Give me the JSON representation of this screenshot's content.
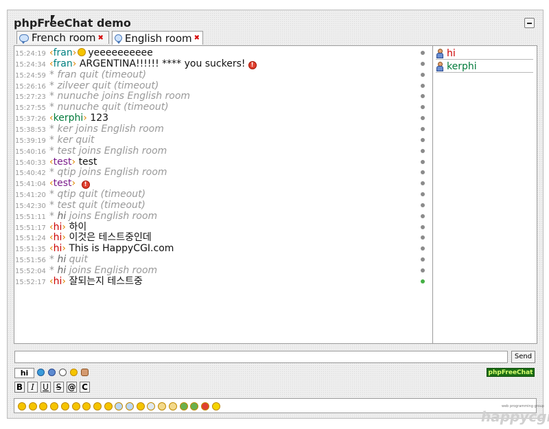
{
  "header": {
    "title": "phpFreeChat demo"
  },
  "tabs": [
    {
      "label": "French room",
      "active": false
    },
    {
      "label": "English room",
      "active": true
    }
  ],
  "messages": [
    {
      "time": "15:24:19",
      "type": "chat",
      "nick": "fran",
      "nick_color": "#008080",
      "emoticon": true,
      "text": "yeeeeeeeeee"
    },
    {
      "time": "15:24:34",
      "type": "chat",
      "nick": "fran",
      "nick_color": "#008080",
      "text": "ARGENTINA!!!!!! **** you suckers!",
      "alert_icon": true
    },
    {
      "time": "15:24:59",
      "type": "system",
      "text": "* fran quit (timeout)"
    },
    {
      "time": "15:26:16",
      "type": "system",
      "text": "* zilveer quit (timeout)"
    },
    {
      "time": "15:27:23",
      "type": "system",
      "text": "* nunuche joins English room"
    },
    {
      "time": "15:27:55",
      "type": "system",
      "text": "* nunuche quit (timeout)"
    },
    {
      "time": "15:37:26",
      "type": "chat",
      "nick": "kerphi",
      "nick_color": "#007a3a",
      "text": "123"
    },
    {
      "time": "15:38:53",
      "type": "system",
      "text": "* ker joins English room"
    },
    {
      "time": "15:39:19",
      "type": "system",
      "text": "* ker quit"
    },
    {
      "time": "15:40:16",
      "type": "system",
      "text": "* test joins English room"
    },
    {
      "time": "15:40:33",
      "type": "chat",
      "nick": "test",
      "nick_color": "#7a1a8a",
      "text": "test"
    },
    {
      "time": "15:40:42",
      "type": "system",
      "text": "* qtip joins English room"
    },
    {
      "time": "15:41:04",
      "type": "chat",
      "nick": "test",
      "nick_color": "#7a1a8a",
      "text": "",
      "alert_icon": true
    },
    {
      "time": "15:41:20",
      "type": "system",
      "text": "* qtip quit (timeout)"
    },
    {
      "time": "15:42:30",
      "type": "system",
      "text": "* test quit (timeout)"
    },
    {
      "time": "15:51:11",
      "type": "system",
      "nick": "hi",
      "text": "joins English room"
    },
    {
      "time": "15:51:17",
      "type": "chat",
      "nick": "hi",
      "nick_color": "#cc0000",
      "text": "하이"
    },
    {
      "time": "15:51:24",
      "type": "chat",
      "nick": "hi",
      "nick_color": "#cc0000",
      "text": "이것은 테스트중인데"
    },
    {
      "time": "15:51:35",
      "type": "chat",
      "nick": "hi",
      "nick_color": "#cc0000",
      "text": "This is HappyCGI.com"
    },
    {
      "time": "15:51:56",
      "type": "system",
      "nick": "hi",
      "text": "quit"
    },
    {
      "time": "15:52:04",
      "type": "system",
      "nick": "hi",
      "text": "joins English room"
    },
    {
      "time": "15:52:17",
      "type": "chat",
      "nick": "hi",
      "nick_color": "#cc0000",
      "text": "잘되는지 테스트중"
    }
  ],
  "users": [
    {
      "name": "hi",
      "color": "#cc0000"
    },
    {
      "name": "kerphi",
      "color": "#007a3a"
    }
  ],
  "composer": {
    "send_label": "Send",
    "nick_label": "hi"
  },
  "format_buttons": [
    "B",
    "I",
    "U",
    "S",
    "@",
    "C"
  ],
  "brand": {
    "badge": "phpFreeChat",
    "logo": "happycgi",
    "logo_tagline": "web programming group"
  },
  "colors": {
    "nick_bracket": "#e08600",
    "timestamp": "#9a9a9a",
    "system_text": "#999999"
  },
  "icons": [
    "chevron-cursor-icon",
    "user-icon",
    "minimize-icon",
    "speech-bubble-icon",
    "close-icon",
    "alert-icon"
  ]
}
